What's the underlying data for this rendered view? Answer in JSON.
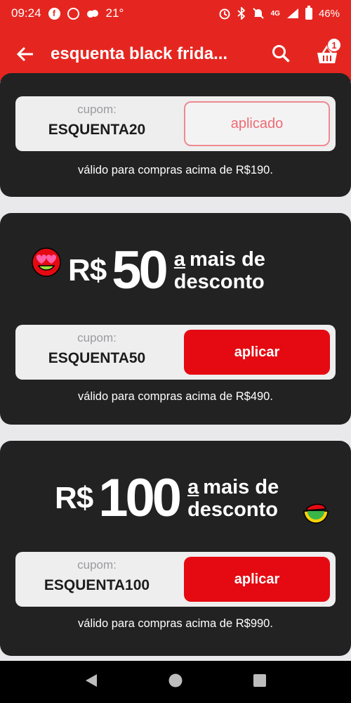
{
  "status_bar": {
    "time": "09:24",
    "temperature": "21°",
    "network": "4G",
    "battery": "46%"
  },
  "app_bar": {
    "title": "esquenta black frida...",
    "cart_count": "1",
    "color": "#e52620"
  },
  "coupons": [
    {
      "label": "cupom:",
      "code": "ESQUENTA20",
      "button": "aplicado",
      "valid": "válido para compras acima de R$190."
    },
    {
      "label": "cupom:",
      "code": "ESQUENTA50",
      "button": "aplicar",
      "valid": "válido para compras acima de R$490.",
      "promo": {
        "currency": "R$",
        "amount": "50",
        "a": "a",
        "line1": "mais de",
        "line2": "desconto"
      }
    },
    {
      "label": "cupom:",
      "code": "ESQUENTA100",
      "button": "aplicar",
      "valid": "válido para compras acima de R$990.",
      "promo": {
        "currency": "R$",
        "amount": "100",
        "a": "a",
        "line1": "mais de",
        "line2": "desconto"
      }
    }
  ],
  "colors": {
    "card_bg": "#222223",
    "apply_red": "#e50a12",
    "page_bg": "#e9e9ec"
  }
}
